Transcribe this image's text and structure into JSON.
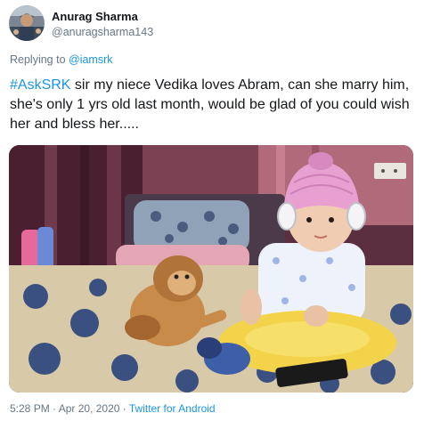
{
  "author": {
    "display_name": "Anurag Sharma",
    "handle": "@anuragsharma143"
  },
  "reply": {
    "prefix": "Replying to ",
    "mention": "@iamsrk"
  },
  "tweet": {
    "hashtag": "#AskSRK",
    "text": " sir my niece Vedika loves Abram, can she marry him, she's only 1 yrs old last month, would be glad of you could wish her and bless her....."
  },
  "media": {
    "type": "photo"
  },
  "meta": {
    "timestamp": "5:28 PM · Apr 20, 2020",
    "separator": " · ",
    "source": "Twitter for Android"
  },
  "colors": {
    "link": "#1b95e0",
    "secondary_text": "#657786",
    "primary_text": "#14171a"
  }
}
